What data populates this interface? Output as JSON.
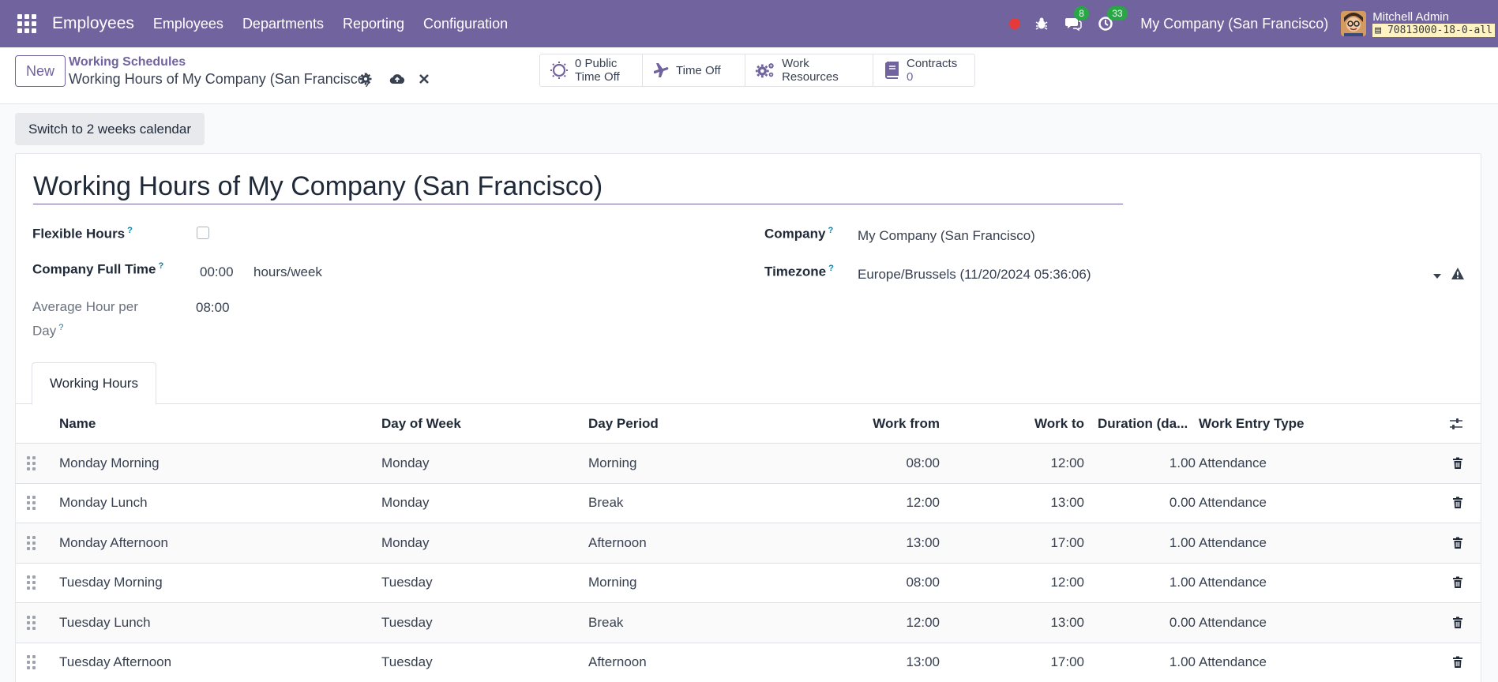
{
  "navbar": {
    "app_name": "Employees",
    "menu": [
      "Employees",
      "Departments",
      "Reporting",
      "Configuration"
    ],
    "messages_count": "8",
    "activities_count": "33",
    "company": "My Company (San Francisco)",
    "user_name": "Mitchell Admin",
    "db_name": "70813000-18-0-all",
    "accent_color": "#71639e"
  },
  "control": {
    "new_label": "New",
    "breadcrumb": "Working Schedules",
    "record_title": "Working Hours of My Company (San Francisco)",
    "smart_buttons": {
      "public_time_off": {
        "count": "0 Public",
        "label": "Time Off"
      },
      "time_off": {
        "label": "Time Off"
      },
      "work_resources": {
        "label": "Work Resources"
      },
      "contracts": {
        "label": "Contracts",
        "count": "0"
      }
    }
  },
  "switch_label": "Switch to 2 weeks calendar",
  "form": {
    "name": "Working Hours of My Company (San Francisco)",
    "flexible_hours_label": "Flexible Hours",
    "flexible_hours_checked": false,
    "company_full_time_label": "Company Full Time",
    "company_full_time_value": "00:00",
    "company_full_time_unit": "hours/week",
    "avg_hour_label_1": "Average Hour per",
    "avg_hour_label_2": "Day",
    "avg_hour_value": "08:00",
    "company_label": "Company",
    "company_value": "My Company (San Francisco)",
    "timezone_label": "Timezone",
    "timezone_value": "Europe/Brussels (11/20/2024 05:36:06)",
    "help_mark": "?"
  },
  "tabs": {
    "working_hours": "Working Hours"
  },
  "table": {
    "headers": {
      "name": "Name",
      "day": "Day of Week",
      "period": "Day Period",
      "from": "Work from",
      "to": "Work to",
      "duration": "Duration (da...",
      "type": "Work Entry Type"
    },
    "rows": [
      {
        "name": "Monday Morning",
        "day": "Monday",
        "period": "Morning",
        "from": "08:00",
        "to": "12:00",
        "duration": "1.00",
        "type": "Attendance"
      },
      {
        "name": "Monday Lunch",
        "day": "Monday",
        "period": "Break",
        "from": "12:00",
        "to": "13:00",
        "duration": "0.00",
        "type": "Attendance"
      },
      {
        "name": "Monday Afternoon",
        "day": "Monday",
        "period": "Afternoon",
        "from": "13:00",
        "to": "17:00",
        "duration": "1.00",
        "type": "Attendance"
      },
      {
        "name": "Tuesday Morning",
        "day": "Tuesday",
        "period": "Morning",
        "from": "08:00",
        "to": "12:00",
        "duration": "1.00",
        "type": "Attendance"
      },
      {
        "name": "Tuesday Lunch",
        "day": "Tuesday",
        "period": "Break",
        "from": "12:00",
        "to": "13:00",
        "duration": "0.00",
        "type": "Attendance"
      },
      {
        "name": "Tuesday Afternoon",
        "day": "Tuesday",
        "period": "Afternoon",
        "from": "13:00",
        "to": "17:00",
        "duration": "1.00",
        "type": "Attendance"
      }
    ]
  }
}
